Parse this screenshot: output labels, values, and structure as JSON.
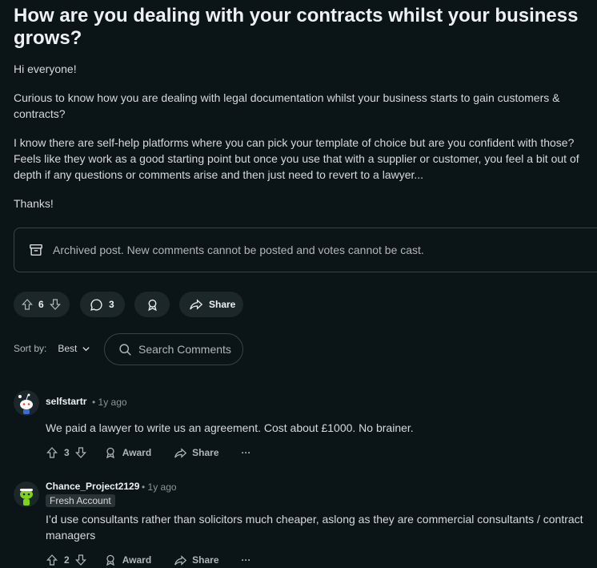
{
  "post": {
    "title": "How are you dealing with your contracts whilst your business grows?",
    "paragraphs": [
      "Hi everyone!",
      "Curious to know how you are dealing with legal documentation whilst your business starts to gain customers & contracts?",
      "I know there are self-help platforms where you can pick your template of choice but are you confident with those? Feels like they work as a good starting point but once you use that with a supplier or customer, you feel a bit out of depth if any questions or comments arise and then just need to revert to a lawyer...",
      "Thanks!"
    ],
    "archived_notice": "Archived post. New comments cannot be posted and votes cannot be cast.",
    "votes": "6",
    "comments_count": "3",
    "share_label": "Share"
  },
  "sort": {
    "label": "Sort by:",
    "value": "Best"
  },
  "search": {
    "placeholder": "Search Comments"
  },
  "comments": [
    {
      "author": "selfstartr",
      "age": "1y ago",
      "text": "We paid a lawyer to write us an agreement. Cost about £1000. No brainer.",
      "votes": "3",
      "award_label": "Award",
      "share_label": "Share",
      "more": "···"
    },
    {
      "author": "Chance_Project2129",
      "age": "1y ago",
      "flair": "Fresh Account",
      "text": "I’d use consultants rather than solicitors much cheaper, aslong as they are commercial consultants / contract managers",
      "votes": "2",
      "award_label": "Award",
      "share_label": "Share",
      "more": "···"
    }
  ],
  "icons": {
    "archive": "archive-box-icon",
    "upvote": "up-arrow-icon",
    "downvote": "down-arrow-icon",
    "comment": "speech-bubble-icon",
    "award": "award-ribbon-icon",
    "share": "share-arrow-icon",
    "search": "magnifier-icon",
    "chevron": "chevron-down-icon"
  },
  "colors": {
    "background": "#0b1416",
    "pill": "#1c2729",
    "text": "#d7dadc",
    "muted": "#b0b7ba"
  }
}
